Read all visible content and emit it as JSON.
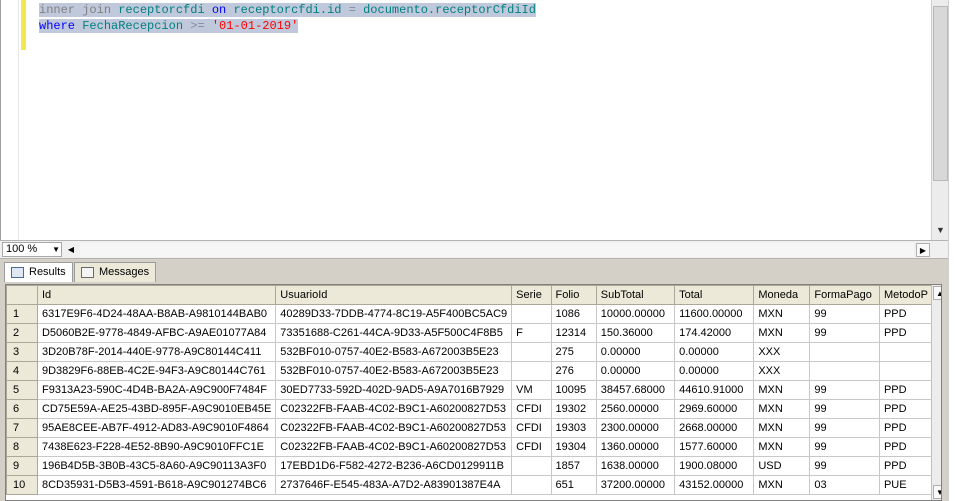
{
  "editor": {
    "line1": {
      "inner": "inner",
      "join": "join",
      "table": "receptorcfdi",
      "on": "on",
      "left": "receptorcfdi.id",
      "eq": "=",
      "right": "documento.receptorCfdiId"
    },
    "line2": {
      "where": "where",
      "field": "FechaRecepcion",
      "op": ">=",
      "value": "'01-01-2019'"
    }
  },
  "zoom": {
    "value": "100 %"
  },
  "tabs": [
    {
      "label": "Results"
    },
    {
      "label": "Messages"
    }
  ],
  "grid": {
    "columns": [
      "Id",
      "UsuarioId",
      "Serie",
      "Folio",
      "SubTotal",
      "Total",
      "Moneda",
      "FormaPago",
      "MetodoP"
    ],
    "rows": [
      {
        "n": "1",
        "cells": [
          "6317E9F6-4D24-48AA-B8AB-A9810144BAB0",
          "40289D33-7DDB-4774-8C19-A5F400BC5AC9",
          "",
          "1086",
          "10000.00000",
          "11600.00000",
          "MXN",
          "99",
          "PPD"
        ]
      },
      {
        "n": "2",
        "cells": [
          "D5060B2E-9778-4849-AFBC-A9AE01077A84",
          "73351688-C261-44CA-9D33-A5F500C4F8B5",
          "F",
          "12314",
          "150.36000",
          "174.42000",
          "MXN",
          "99",
          "PPD"
        ]
      },
      {
        "n": "3",
        "cells": [
          "3D20B78F-2014-440E-9778-A9C80144C411",
          "532BF010-0757-40E2-B583-A672003B5E23",
          "",
          "275",
          "0.00000",
          "0.00000",
          "XXX",
          "",
          ""
        ]
      },
      {
        "n": "4",
        "cells": [
          "9D3829F6-88EB-4C2E-94F3-A9C80144C761",
          "532BF010-0757-40E2-B583-A672003B5E23",
          "",
          "276",
          "0.00000",
          "0.00000",
          "XXX",
          "",
          ""
        ]
      },
      {
        "n": "5",
        "cells": [
          "F9313A23-590C-4D4B-BA2A-A9C900F7484F",
          "30ED7733-592D-402D-9AD5-A9A7016B7929",
          "VM",
          "10095",
          "38457.68000",
          "44610.91000",
          "MXN",
          "99",
          "PPD"
        ]
      },
      {
        "n": "6",
        "cells": [
          "CD75E59A-AE25-43BD-895F-A9C9010EB45E",
          "C02322FB-FAAB-4C02-B9C1-A60200827D53",
          "CFDI",
          "19302",
          "2560.00000",
          "2969.60000",
          "MXN",
          "99",
          "PPD"
        ]
      },
      {
        "n": "7",
        "cells": [
          "95AE8CEE-AB7F-4912-AD83-A9C9010F4864",
          "C02322FB-FAAB-4C02-B9C1-A60200827D53",
          "CFDI",
          "19303",
          "2300.00000",
          "2668.00000",
          "MXN",
          "99",
          "PPD"
        ]
      },
      {
        "n": "8",
        "cells": [
          "7438E623-F228-4E52-8B90-A9C9010FFC1E",
          "C02322FB-FAAB-4C02-B9C1-A60200827D53",
          "CFDI",
          "19304",
          "1360.00000",
          "1577.60000",
          "MXN",
          "99",
          "PPD"
        ]
      },
      {
        "n": "9",
        "cells": [
          "196B4D5B-3B0B-43C5-8A60-A9C90113A3F0",
          "17EBD1D6-F582-4272-B236-A6CD0129911B",
          "",
          "1857",
          "1638.00000",
          "1900.08000",
          "USD",
          "99",
          "PPD"
        ]
      },
      {
        "n": "10",
        "cells": [
          "8CD35931-D5B3-4591-B618-A9C901274BC6",
          "2737646F-E545-483A-A7D2-A83901387E4A",
          "",
          "651",
          "37200.00000",
          "43152.00000",
          "MXN",
          "03",
          "PUE"
        ]
      }
    ]
  }
}
